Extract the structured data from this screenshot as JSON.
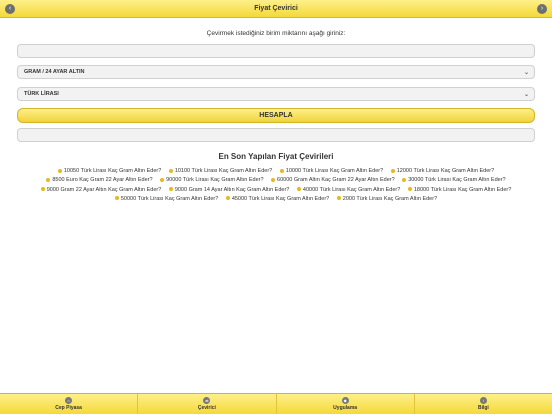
{
  "header": {
    "title": "Fiyat Çevirici",
    "back_icon": "chevron-left-icon",
    "forward_icon": "chevron-right-icon",
    "back_glyph": "‹",
    "forward_glyph": "›"
  },
  "form": {
    "prompt": "Çevirmek istediğiniz birim miktarını aşağı giriniz:",
    "amount_value": "",
    "from_unit": "GRAM / 24 AYAR ALTIN",
    "to_unit": "TÜRK LİRASI",
    "calculate_label": "HESAPLA",
    "result_value": ""
  },
  "recent": {
    "title": "En Son Yapılan Fiyat Çevirileri",
    "items": [
      "10050 Türk Lirası Kaç Gram Altın Eder?",
      "10100 Türk Lirası Kaç Gram Altın Eder?",
      "10000 Türk Lirası Kaç Gram Altın Eder?",
      "12000 Türk Lirası Kaç Gram Altın Eder?",
      "8500 Euro Kaç Gram 22 Ayar Altın Eder?",
      "90000 Türk Lirası Kaç Gram Altın Eder?",
      "60000 Gram Altın Kaç Gram 22 Ayar Altın Eder?",
      "30000 Türk Lirası Kaç Gram Altın Eder?",
      "9000 Gram 22 Ayar Altın Kaç Gram Altın Eder?",
      "9000 Gram 14 Ayar Altın Kaç Gram Altın Eder?",
      "40000 Türk Lirası Kaç Gram Altın Eder?",
      "18000 Türk Lirası Kaç Gram Altın Eder?",
      "50000 Türk Lirası Kaç Gram Altın Eder?",
      "45000 Türk Lirası Kaç Gram Altın Eder?",
      "2000 Türk Lirası Kaç Gram Altın Eder?"
    ]
  },
  "tabs": [
    {
      "label": "Cep Piyasa",
      "icon": "home-icon"
    },
    {
      "label": "Çevirici",
      "icon": "converter-icon"
    },
    {
      "label": "Uygulama",
      "icon": "apps-icon"
    },
    {
      "label": "Bilgi",
      "icon": "info-icon"
    }
  ],
  "colors": {
    "accent": "#f4d93a",
    "bullet": "#e8b820"
  }
}
